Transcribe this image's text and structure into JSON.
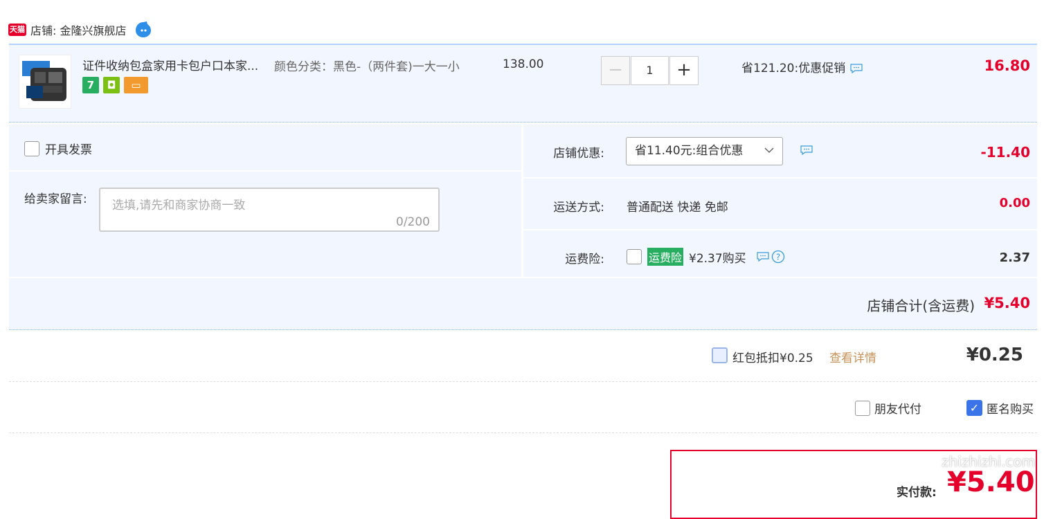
{
  "store": {
    "badge": "天猫",
    "label": "店铺: 金隆兴旗舰店"
  },
  "product": {
    "title": "证件收纳包盒家用卡包户口本家...",
    "sku": "颜色分类：黑色-（两件套)一大一小",
    "unit_price": "138.00",
    "quantity": "1",
    "save_text": "省121.20:优惠促销",
    "total": "16.80"
  },
  "options": {
    "invoice_label": "开具发票",
    "message_label": "给卖家留言:",
    "message_placeholder": "选填,请先和商家协商一致",
    "message_count": "0/200",
    "discount_label": "店铺优惠:",
    "discount_value_text": "省11.40元:组合优惠",
    "discount_amount": "-11.40",
    "shipping_label": "运送方式:",
    "shipping_text": "普通配送 快递 免邮",
    "shipping_amount": "0.00",
    "insurance_label": "运费险:",
    "insurance_tag": "运费险",
    "insurance_text": "¥2.37购买",
    "insurance_amount": "2.37"
  },
  "store_total": {
    "label": "店铺合计(含运费)",
    "value": "¥5.40"
  },
  "red_packet": {
    "label": "红包抵扣¥0.25",
    "link": "查看详情",
    "value": "¥0.25"
  },
  "extras": {
    "friend_pay": "朋友代付",
    "anonymous": "匿名购买",
    "anonymous_checked": true
  },
  "pay": {
    "label": "实付款:",
    "value": "¥5.40"
  },
  "watermark": "zhizhizhi.com",
  "colors": {
    "price_red": "#e4002b",
    "section_bg": "#f2f7ff",
    "checkbox_blue": "#3b74e8"
  }
}
